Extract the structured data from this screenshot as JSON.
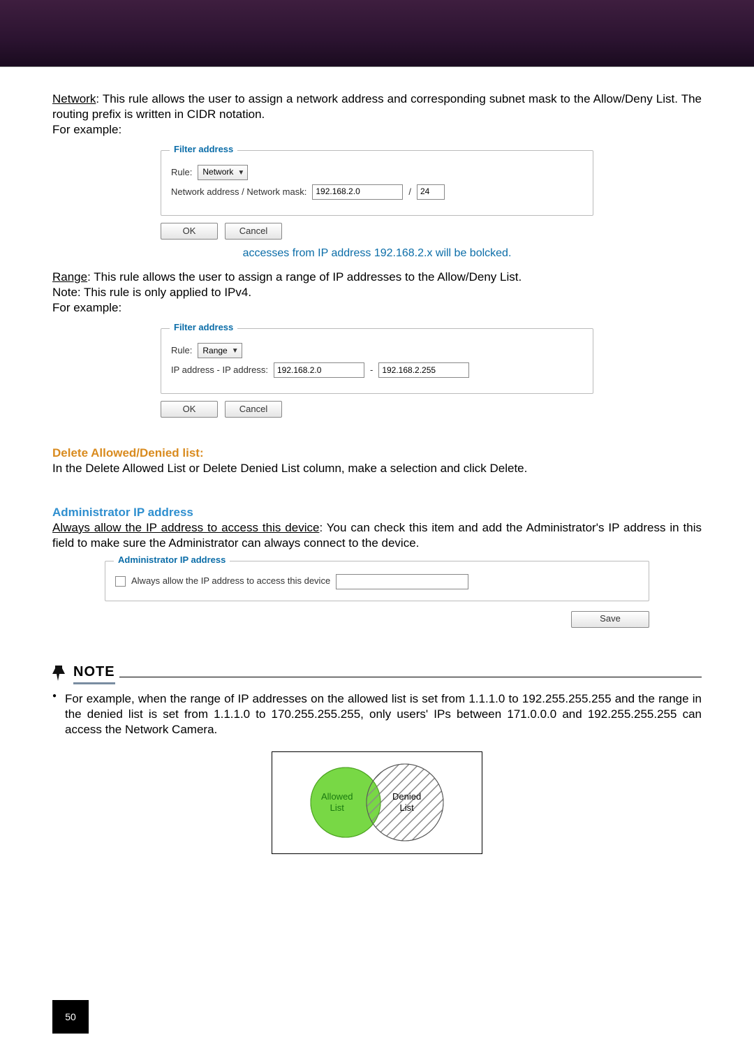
{
  "banner": {},
  "intro_network": {
    "label": "Network",
    "text": ": This rule allows the user to assign a network address and corresponding subnet mask to the Allow/Deny List. The routing prefix is written in CIDR notation.",
    "for_example": "For example:"
  },
  "screenshot1": {
    "legend": "Filter address",
    "rule_label": "Rule:",
    "rule_value": "Network",
    "addr_label": "Network address / Network mask:",
    "addr_value": "192.168.2.0",
    "slash": "/",
    "mask_value": "24",
    "ok": "OK",
    "cancel": "Cancel"
  },
  "caption1": "accesses from IP address 192.168.2.x will be bolcked.",
  "intro_range": {
    "label": "Range",
    "text": ": This rule allows the user to assign a range of IP addresses to the Allow/Deny List.",
    "note": "Note: This rule is only applied to IPv4.",
    "for_example": "For example:"
  },
  "screenshot2": {
    "legend": "Filter address",
    "rule_label": "Rule:",
    "rule_value": "Range",
    "addr_label": "IP address - IP address:",
    "addr_from": "192.168.2.0",
    "dash": "-",
    "addr_to": "192.168.2.255",
    "ok": "OK",
    "cancel": "Cancel"
  },
  "delete_section": {
    "heading": "Delete Allowed/Denied list:",
    "text": "In the Delete Allowed List or Delete Denied List column, make a selection and click Delete."
  },
  "admin_section": {
    "heading": "Administrator IP address",
    "underline": "Always allow the IP address to access this device",
    "rest": ": You can check this item and add the Administrator's IP address in this field to make sure the Administrator can always connect to the device."
  },
  "screenshot3": {
    "legend": "Administrator IP address",
    "checkbox_label": "Always allow the IP address to access this device",
    "input_value": "",
    "save": "Save"
  },
  "note": {
    "title": "NOTE",
    "item": "For example, when the range of IP addresses on the allowed list is set from 1.1.1.0 to 192.255.255.255 and the range in the denied list is set from 1.1.1.0 to 170.255.255.255, only users' IPs between 171.0.0.0 and 192.255.255.255 can access the Network Camera."
  },
  "venn": {
    "allowed_line1": "Allowed",
    "allowed_line2": "List",
    "denied_line1": "Denied",
    "denied_line2": "List",
    "colors": {
      "allowed": "#78d845",
      "hatch": "#8a8a8a",
      "stroke": "#555"
    }
  },
  "page_number": "50"
}
